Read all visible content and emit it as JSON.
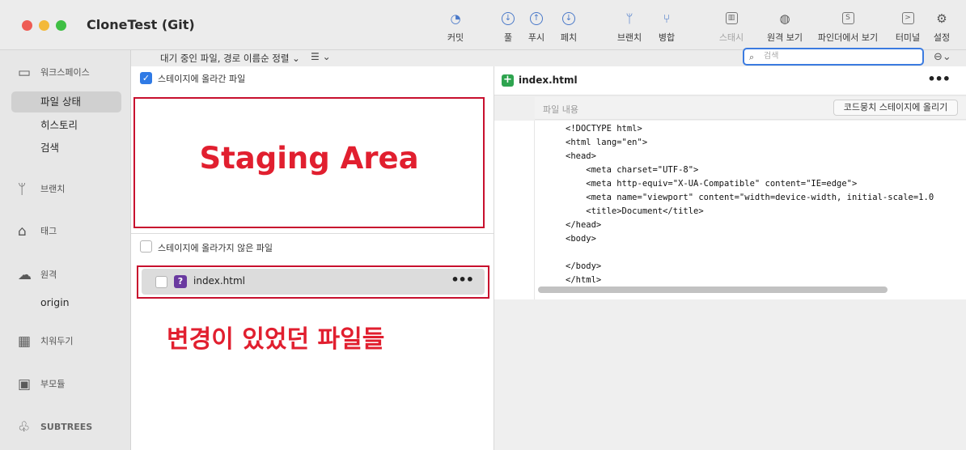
{
  "window": {
    "title": "CloneTest (Git)",
    "traffic_lights": [
      "#ee5c54",
      "#f3b93a",
      "#3fbf44"
    ]
  },
  "toolbar": [
    {
      "label": "커밋",
      "icon": "commit-icon",
      "glyph": "◔",
      "dim": false
    },
    {
      "label": "풀",
      "icon": "pull-icon",
      "glyph": "↓",
      "dim": false
    },
    {
      "label": "푸시",
      "icon": "push-icon",
      "glyph": "↑",
      "dim": false
    },
    {
      "label": "페치",
      "icon": "fetch-icon",
      "glyph": "⇣",
      "dim": false
    },
    {
      "label": "브랜치",
      "icon": "branch-icon",
      "glyph": "ᛘ",
      "dim": false
    },
    {
      "label": "병합",
      "icon": "merge-icon",
      "glyph": "⑂",
      "dim": false
    },
    {
      "label": "스태시",
      "icon": "stash-icon",
      "glyph": "▥",
      "dim": true
    },
    {
      "label": "원격 보기",
      "icon": "globe-icon",
      "glyph": "◍",
      "dim": false
    },
    {
      "label": "파인더에서 보기",
      "icon": "finder-icon",
      "glyph": "S",
      "dim": false
    },
    {
      "label": "터미널",
      "icon": "terminal-icon",
      "glyph": ">_",
      "dim": false
    },
    {
      "label": "설정",
      "icon": "gear-icon",
      "glyph": "⚙",
      "dim": false
    }
  ],
  "sidebar": {
    "workspace": {
      "label": "워크스페이스",
      "icon": "monitor-icon"
    },
    "workspace_items": [
      {
        "label": "파일 상태",
        "selected": true
      },
      {
        "label": "히스토리",
        "selected": false
      },
      {
        "label": "검색",
        "selected": false
      }
    ],
    "branches": {
      "label": "브랜치",
      "icon": "branch-icon"
    },
    "tags": {
      "label": "태그",
      "icon": "tag-icon"
    },
    "remotes": {
      "label": "원격",
      "icon": "cloud-icon",
      "items": [
        "origin"
      ]
    },
    "stashes": {
      "label": "치워두기",
      "icon": "stash-icon"
    },
    "submodules": {
      "label": "부모듈",
      "icon": "folder-icon"
    },
    "subtrees": {
      "label": "SUBTREES",
      "icon": "subtree-icon"
    }
  },
  "filterbar": {
    "sort_label": "대기 중인 파일, 경로 이름순 정렬 ⌄",
    "list_toggle": "☰ ⌄",
    "search_placeholder": "검색",
    "filter_menu": "⊖⌄"
  },
  "staged": {
    "label": "스테이지에 올라간 파일",
    "checked": true,
    "annotation": "Staging Area"
  },
  "unstaged": {
    "label": "스테이지에 올라가지 않은 파일",
    "files": [
      {
        "name": "index.html",
        "status": "?"
      }
    ],
    "annotation": "변경이 있었던 파일들"
  },
  "diff": {
    "file_name": "index.html",
    "hunk_label": "파일 내용",
    "stage_hunk_button": "코드뭉치 스테이지에 올리기",
    "lines": [
      "<!DOCTYPE html>",
      "<html lang=\"en\">",
      "<head>",
      "    <meta charset=\"UTF-8\">",
      "    <meta http-equiv=\"X-UA-Compatible\" content=\"IE=edge\">",
      "    <meta name=\"viewport\" content=\"width=device-width, initial-scale=1.0",
      "    <title>Document</title>",
      "</head>",
      "<body>",
      "",
      "</body>",
      "</html>"
    ]
  },
  "colors": {
    "annotation_red": "#e11f2f",
    "accent_blue": "#2f7ae5",
    "added_green": "#2ea44f"
  }
}
